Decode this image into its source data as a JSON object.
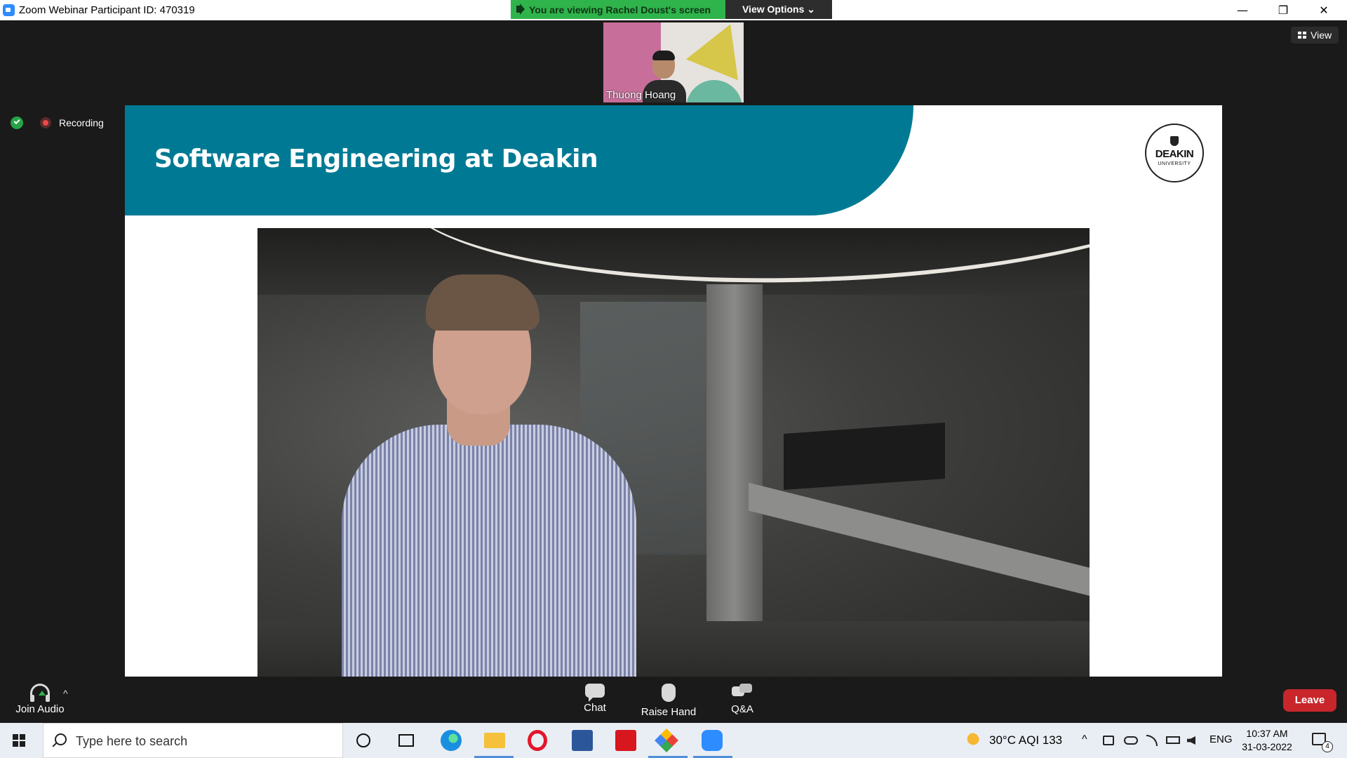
{
  "window": {
    "title": "Zoom Webinar Participant ID: 470319",
    "minimize": "—",
    "restore": "❐",
    "close": "✕"
  },
  "share_banner": {
    "text": "You are viewing Rachel Doust's screen",
    "view_options": "View Options ⌄"
  },
  "thumbnail": {
    "name": "Thuong Hoang"
  },
  "view_button": {
    "label": "View"
  },
  "status": {
    "recording_label": "Recording"
  },
  "slide": {
    "title": "Software Engineering at Deakin",
    "logo_line1": "DEAKIN",
    "logo_line2": "UNIVERSITY",
    "banner_color": "#007a94"
  },
  "toolbar": {
    "join_audio": "Join Audio",
    "audio_caret": "^",
    "chat": "Chat",
    "raise_hand": "Raise Hand",
    "qa": "Q&A",
    "leave": "Leave"
  },
  "taskbar": {
    "search_placeholder": "Type here to search",
    "weather": "30°C  AQI 133",
    "tray_chevron": "^",
    "language": "ENG",
    "time": "10:37 AM",
    "date": "31-03-2022",
    "notification_count": "4",
    "apps": [
      "cortana-icon",
      "task-view-icon",
      "edge-icon",
      "file-explorer-icon",
      "opera-icon",
      "word-icon",
      "acrobat-icon",
      "git-icon",
      "zoom-icon"
    ]
  }
}
